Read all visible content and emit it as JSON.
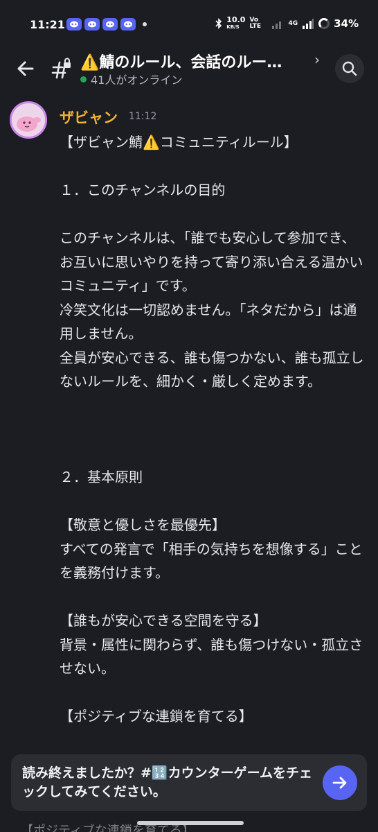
{
  "status_bar": {
    "time": "11:21",
    "network_speed": "10.0",
    "network_unit": "KB/S",
    "volte": "Vo LTE",
    "signal_label": "4G",
    "battery": "34%"
  },
  "header": {
    "channel_title": "⚠️鯖のルール、会話のルー…",
    "chevron": "›",
    "online_count": "41人がオンライン",
    "icons": {
      "back": "arrow-left-icon",
      "channel": "locked-hash-icon",
      "search": "search-icon"
    }
  },
  "message": {
    "author": "ザビャン",
    "author_color": "#f0b232",
    "timestamp": "11:12",
    "body": "【ザビャン鯖⚠️コミュニティルール】\n\n１．このチャンネルの目的\n\nこのチャンネルは、「誰でも安心して参加でき、お互いに思いやりを持って寄り添い合える温かいコミュニティ」です。\n冷笑文化は一切認めません。「ネタだから」は通用しません。\n全員が安心できる、誰も傷つかない、誰も孤立しないルールを、細かく・厳しく定めます。\n\n\n\n２．基本原則\n\n【敬意と優しさを最優先】\nすべての発言で「相手の気持ちを想像する」ことを義務付けます。\n\n【誰もが安心できる空間を守る】\n背景・属性に関わらず、誰も傷つけない・孤立させない。\n\n【ポジティブな連鎖を育てる】"
  },
  "nudge": {
    "text": "読み終えましたか？#🔢カウンターゲームをチェックしてみてください。",
    "button_icon": "arrow-right-icon",
    "accent": "#5865f2"
  },
  "peek": {
    "text": "【ポジティブな連鎖を育てる】"
  },
  "colors": {
    "background": "#1c1d22",
    "online": "#23a55a"
  }
}
